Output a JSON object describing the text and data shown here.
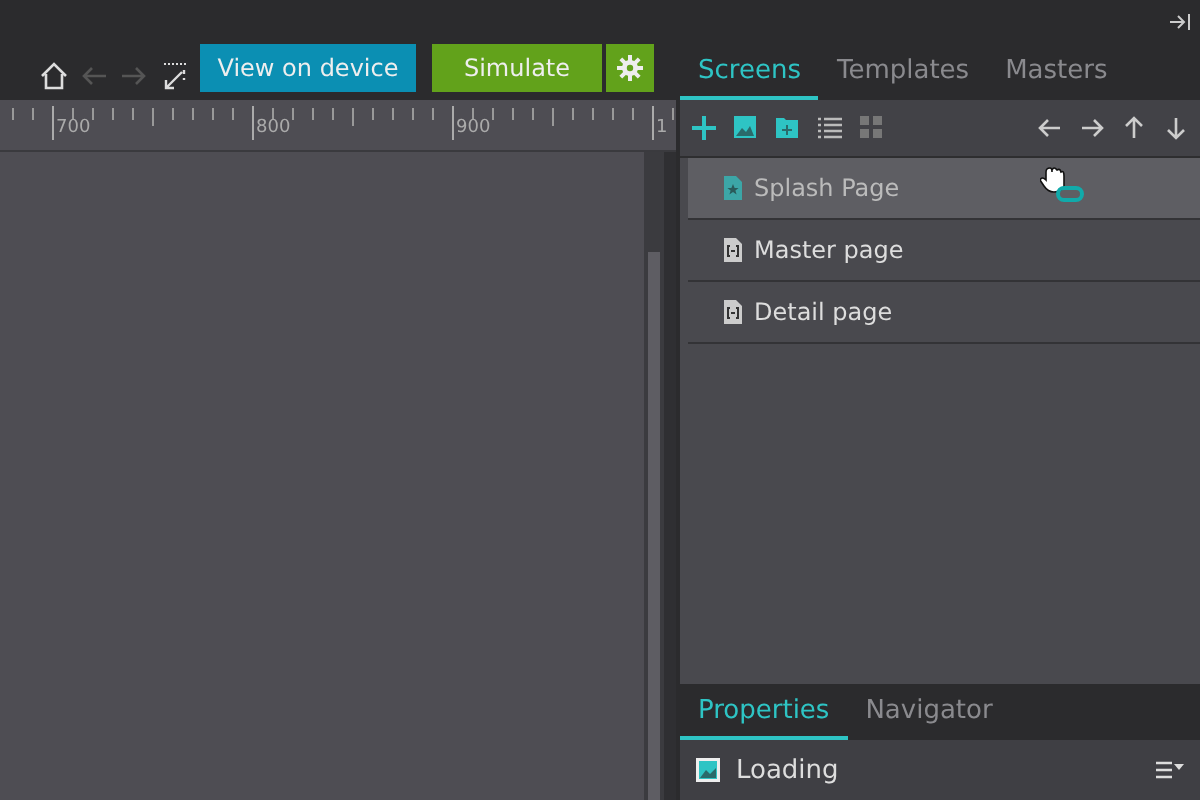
{
  "toolbar": {
    "buttons": [
      {
        "label": "View on device",
        "kind": "device"
      },
      {
        "label": "Simulate",
        "kind": "simulate"
      }
    ]
  },
  "ruler": {
    "labels": [
      "700",
      "800",
      "900",
      "1"
    ]
  },
  "screens_panel": {
    "tabs": [
      {
        "label": "Screens",
        "selected": true
      },
      {
        "label": "Templates",
        "selected": false
      },
      {
        "label": "Masters",
        "selected": false
      }
    ],
    "items": [
      {
        "label": "Splash Page",
        "kind": "splash",
        "selected": true
      },
      {
        "label": "Master page",
        "kind": "page",
        "selected": false
      },
      {
        "label": "Detail page",
        "kind": "page",
        "selected": false
      }
    ]
  },
  "properties_panel": {
    "tabs": [
      {
        "label": "Properties",
        "selected": true
      },
      {
        "label": "Navigator",
        "selected": false
      }
    ],
    "element": "Loading"
  }
}
